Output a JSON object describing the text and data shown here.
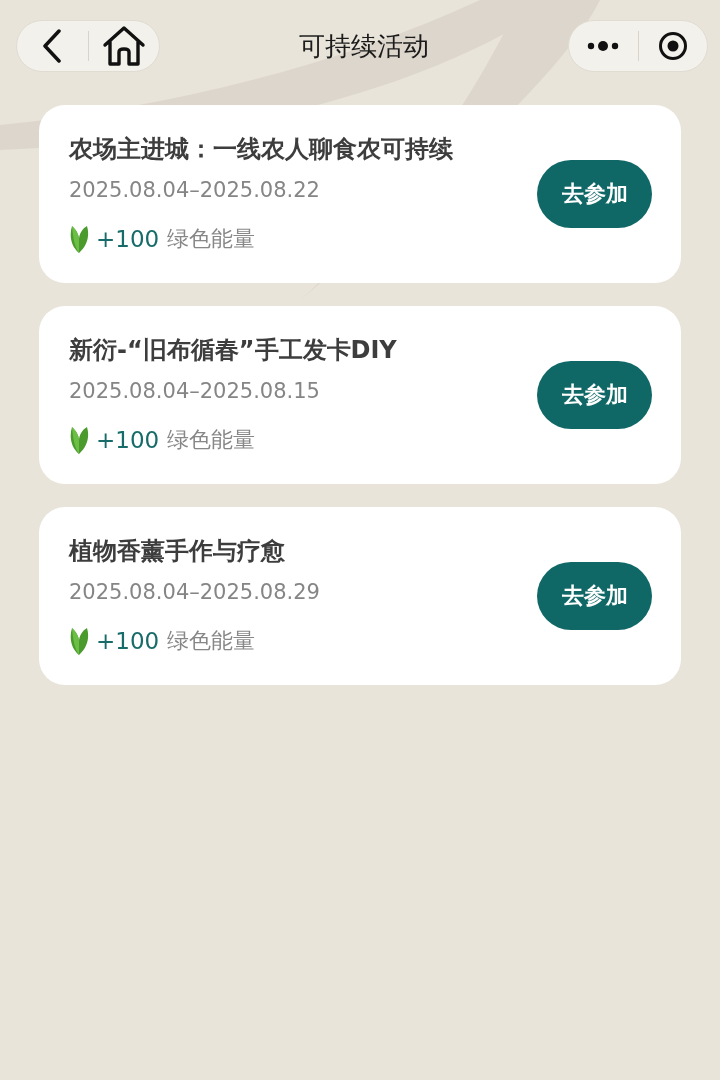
{
  "nav": {
    "title": "可持续活动"
  },
  "activities": [
    {
      "title": "农场主进城：一线农人聊食农可持续",
      "dates": "2025.08.04–2025.08.22",
      "points": "+100",
      "points_label": "绿色能量",
      "button": "去参加"
    },
    {
      "title": "新衍-“旧布循春”手工发卡DIY",
      "dates": "2025.08.04–2025.08.15",
      "points": "+100",
      "points_label": "绿色能量",
      "button": "去参加"
    },
    {
      "title": "植物香薰手作与疗愈",
      "dates": "2025.08.04–2025.08.29",
      "points": "+100",
      "points_label": "绿色能量",
      "button": "去参加"
    }
  ]
}
